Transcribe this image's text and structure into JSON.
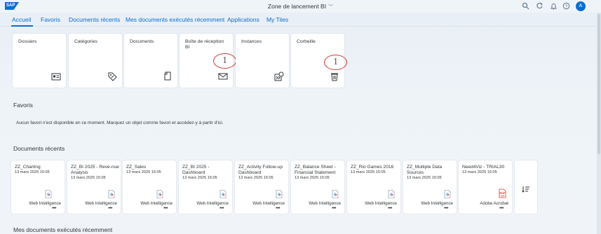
{
  "shell": {
    "logo": "SAP",
    "title": "Zone de lancement BI",
    "avatar": "A",
    "icons": [
      "search-icon",
      "refresh-icon",
      "bell-icon",
      "help-icon"
    ]
  },
  "tabs": [
    {
      "label": "Accueil",
      "active": true
    },
    {
      "label": "Favoris"
    },
    {
      "label": "Documents récents"
    },
    {
      "label": "Mes documents exécutés récemment"
    },
    {
      "label": "Applications"
    },
    {
      "label": "My Tiles"
    }
  ],
  "tiles": [
    {
      "label": "Dossiers",
      "icon": "folder-card-icon"
    },
    {
      "label": "Catégories",
      "icon": "tag-icon"
    },
    {
      "label": "Documents",
      "icon": "documents-icon"
    },
    {
      "label": "Boîte de réception BI",
      "icon": "mail-icon",
      "badge": "1"
    },
    {
      "label": "Instances",
      "icon": "instances-icon"
    },
    {
      "label": "Corbeille",
      "icon": "trash-icon",
      "badge": "1"
    }
  ],
  "favorites": {
    "title": "Favoris",
    "message": "Aucun favori n'est disponible en ce moment. Marquez un objet comme favori et accédez-y à partir d'ici."
  },
  "recent": {
    "title": "Documents récents",
    "items": [
      {
        "title": "ZZ_Charting",
        "date": "13 mars 2025 15:05",
        "type": "Web Intelligence",
        "more": "•••"
      },
      {
        "title": "ZZ_BI 2025 - Reve-nue Analysis",
        "date": "13 mars 2025 15:05",
        "type": "Web Intelligence",
        "more": "•••"
      },
      {
        "title": "ZZ_Sales",
        "date": "13 mars 2025 15:05",
        "type": "Web Intelligence",
        "more": "•••"
      },
      {
        "title": "ZZ_BI 2025 - Dashboard",
        "date": "13 mars 2025 15:05",
        "type": "Web Intelligence",
        "more": "•••"
      },
      {
        "title": "ZZ_Activity Follow-up Dashboard",
        "date": "13 mars 2025 15:05",
        "type": "Web Intelligence",
        "more": "•••"
      },
      {
        "title": "ZZ_Balance Sheet - Financial Statement",
        "date": "13 mars 2025 15:05",
        "type": "Web Intelligence",
        "more": "•••"
      },
      {
        "title": "ZZ_Rio Games 2016",
        "date": "13 mars 2025 15:05",
        "type": "Web Intelligence",
        "more": "•••"
      },
      {
        "title": "ZZ_Multiple Data Sources",
        "date": "13 mars 2025 15:05",
        "type": "Web Intelligence",
        "more": "•••"
      },
      {
        "title": "Need4Viz - TRIAL30",
        "date": "13 mars 2025 15:05",
        "type": "Adobe Acrobat",
        "more": "•••"
      }
    ]
  },
  "executed": {
    "title": "Mes documents exécutés récemment"
  },
  "colors": {
    "accent": "#0a6ed1",
    "badge": "#d0352f",
    "pdf": "#e2311d"
  }
}
